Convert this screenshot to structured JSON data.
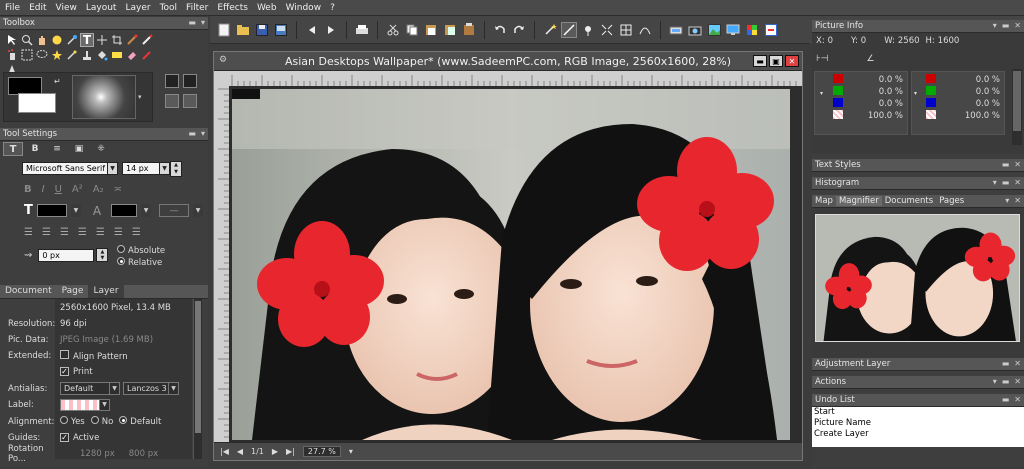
{
  "menu": [
    "File",
    "Edit",
    "View",
    "Layout",
    "Layer",
    "Tool",
    "Filter",
    "Effects",
    "Web",
    "Window",
    "?"
  ],
  "toolbox": {
    "title": "Toolbox",
    "fg_color": "#000000",
    "bg_color": "#ffffff"
  },
  "tool_settings": {
    "title": "Tool Settings",
    "font_family": "Microsoft Sans Serif",
    "font_size": "14 px",
    "stroke_width": "0 px",
    "smoothing_options": [
      "Absolute",
      "Relative"
    ],
    "smoothing_selected": "Relative",
    "fill_color": "#000000"
  },
  "props": {
    "tabs": [
      "Document",
      "Page",
      "Layer"
    ],
    "active_tab": "Layer",
    "size_info": "2560x1600 Pixel, 13.4 MB",
    "resolution_label": "Resolution:",
    "resolution": "96 dpi",
    "pic_data_label": "Pic. Data:",
    "pic_data": "JPEG Image (1.69 MB)",
    "extended_label": "Extended:",
    "align_pattern": "Align Pattern",
    "print": "Print",
    "antialias_label": "Antialias:",
    "antialias": "Default",
    "resample": "Lanczos 3",
    "label_label": "Label:",
    "alignment_label": "Alignment:",
    "alignment_options": [
      "Yes",
      "No",
      "Default"
    ],
    "alignment_selected": "Default",
    "guides_label": "Guides:",
    "guides": "Active",
    "rotation_label": "Rotation Po...",
    "rotation_x": "1280 px",
    "rotation_y": "800 px"
  },
  "document": {
    "title": "Asian Desktops Wallpaper* (www.SadeemPC.com, RGB Image, 2560x1600, 28%)",
    "zoom": "27.7 %",
    "page": "1/1"
  },
  "picture_info": {
    "title": "Picture Info",
    "x_label": "X:",
    "x": "0",
    "y_label": "Y:",
    "y": "0",
    "w_label": "W:",
    "w": "2560",
    "h_label": "H:",
    "h": "1600",
    "channels_left": [
      "0.0 %",
      "0.0 %",
      "0.0 %",
      "100.0 %"
    ],
    "channels_right": [
      "0.0 %",
      "0.0 %",
      "0.0 %",
      "100.0 %"
    ]
  },
  "panels": {
    "text_styles": "Text Styles",
    "histogram": "Histogram",
    "map_tabs": [
      "Map",
      "Magnifier",
      "Documents",
      "Pages"
    ],
    "adjustment_layer": "Adjustment Layer",
    "actions": "Actions",
    "undo_list": "Undo List",
    "undo_items": [
      "Start",
      "Picture Name",
      "Create Layer"
    ]
  },
  "colors": {
    "accent_red": "#e8262e",
    "panel_bg": "#3e3e3e",
    "title_bg": "#565656"
  }
}
